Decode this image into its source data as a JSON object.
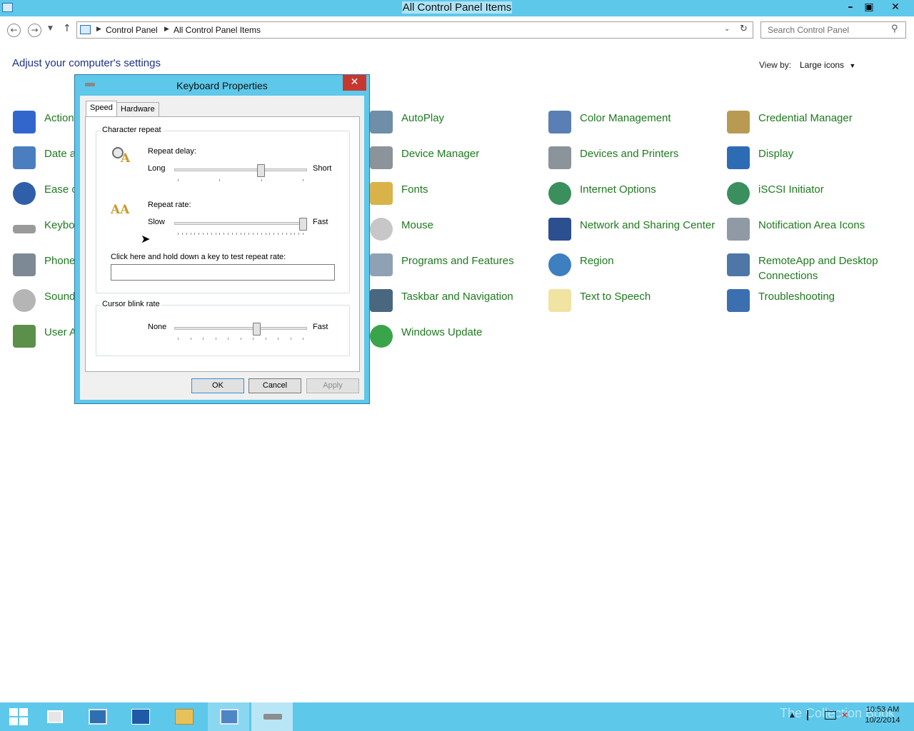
{
  "window": {
    "title": "All Control Panel Items"
  },
  "address": {
    "crumbs": [
      "Control Panel",
      "All Control Panel Items"
    ],
    "search_placeholder": "Search Control Panel"
  },
  "page": {
    "heading": "Adjust your computer's settings",
    "view_by_label": "View by:",
    "view_by_value": "Large icons"
  },
  "items": {
    "col1": [
      "Action",
      "Date a",
      "Ease o",
      "Keybo",
      "Phone",
      "Sound",
      "User A"
    ],
    "col2": [
      "AutoPlay",
      "Device Manager",
      "Fonts",
      "Mouse",
      "Programs and Features",
      "Taskbar and Navigation",
      "Windows Update"
    ],
    "col3": [
      "Color Management",
      "Devices and Printers",
      "Internet Options",
      "Network and Sharing Center",
      "Region",
      "Text to Speech"
    ],
    "col4": [
      "Credential Manager",
      "Display",
      "iSCSI Initiator",
      "Notification Area Icons",
      "RemoteApp and Desktop Connections",
      "Troubleshooting"
    ]
  },
  "dialog": {
    "title": "Keyboard Properties",
    "tabs": [
      "Speed",
      "Hardware"
    ],
    "char_repeat_group": "Character repeat",
    "repeat_delay": {
      "label": "Repeat delay:",
      "min": "Long",
      "max": "Short",
      "value": 0.66
    },
    "repeat_rate": {
      "label": "Repeat rate:",
      "min": "Slow",
      "max": "Fast",
      "value": 1.0
    },
    "test_label": "Click here and hold down a key to test repeat rate:",
    "test_value": "",
    "cursor_group": "Cursor blink rate",
    "cursor_blink": {
      "min": "None",
      "max": "Fast",
      "value": 0.63
    },
    "buttons": {
      "ok": "OK",
      "cancel": "Cancel",
      "apply": "Apply"
    }
  },
  "taskbar": {
    "time": "10:53 AM",
    "date": "10/2/2014",
    "watermark": "The Collection Book"
  },
  "colors": {
    "accent": "#5dc8ea",
    "link": "#1e7a1e",
    "heading": "#1e3287"
  }
}
